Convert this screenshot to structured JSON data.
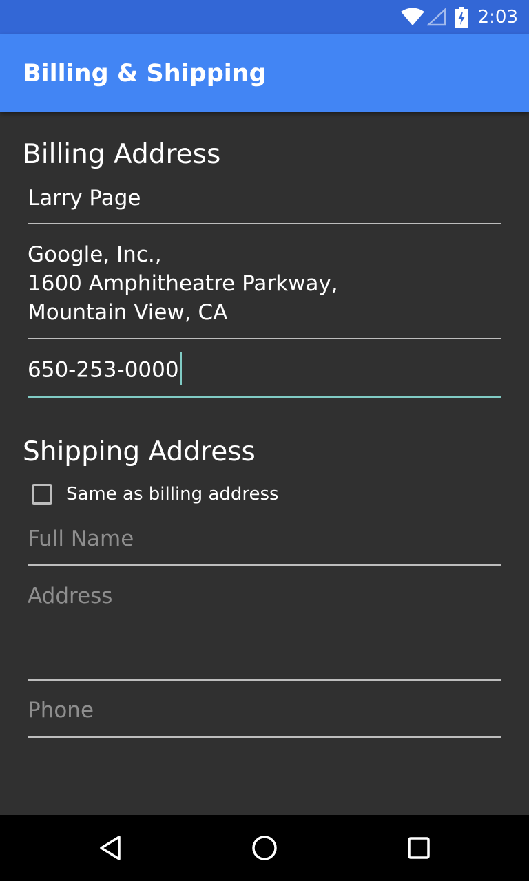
{
  "status_bar": {
    "time": "2:03",
    "icons": [
      "wifi-icon",
      "cell-signal-icon",
      "battery-charging-icon"
    ]
  },
  "app_bar": {
    "title": "Billing & Shipping"
  },
  "billing": {
    "heading": "Billing Address",
    "name_value": "Larry Page",
    "address_value": "Google, Inc.,\n1600 Amphitheatre Parkway,\nMountain View, CA",
    "phone_value": "650-253-0000"
  },
  "shipping": {
    "heading": "Shipping Address",
    "same_as_billing_label": "Same as billing address",
    "same_as_billing_checked": false,
    "name_placeholder": "Full Name",
    "address_placeholder": "Address",
    "phone_placeholder": "Phone"
  },
  "nav_bar": {
    "buttons": [
      "back-icon",
      "home-icon",
      "recents-icon"
    ]
  },
  "colors": {
    "status_bar": "#3367d6",
    "app_bar": "#4285f4",
    "background": "#303030",
    "accent": "#80cbc4",
    "hint_text": "#8e8e8e",
    "underline": "#bdbdbd"
  }
}
